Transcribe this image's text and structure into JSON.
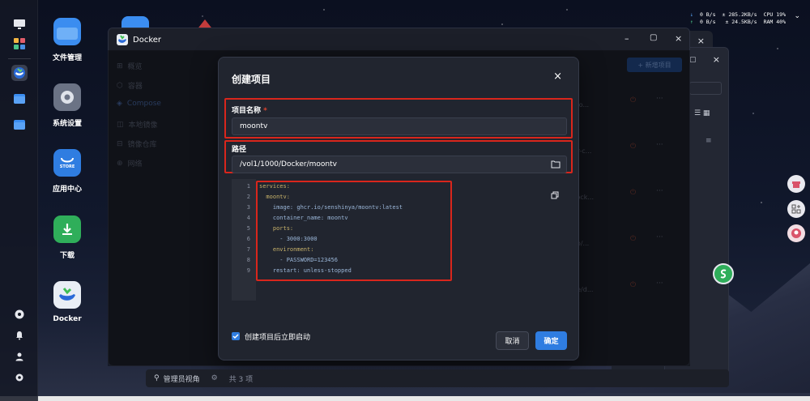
{
  "desktop": {
    "icons": [
      {
        "label": "文件管理"
      },
      {
        "label": "系统设置"
      },
      {
        "label": "应用中心",
        "sublabel": "STORE"
      },
      {
        "label": "下载"
      },
      {
        "label": "Docker"
      }
    ]
  },
  "status": {
    "net_up_label": "0 B/s",
    "net_down_label": "0 B/s",
    "net_up2": "285.2KB/s",
    "net_down2": "24.5KB/s",
    "cpu_label": "CPU",
    "cpu_value": "19%",
    "ram_label": "RAM",
    "ram_value": "40%"
  },
  "window": {
    "title": "Docker",
    "sidebar": [
      {
        "label": "概览",
        "icon": "grid-icon"
      },
      {
        "label": "容器",
        "icon": "cube-icon"
      },
      {
        "label": "Compose",
        "icon": "layers-icon"
      },
      {
        "label": "本地镜像",
        "icon": "image-icon"
      },
      {
        "label": "镜像仓库",
        "icon": "storage-icon"
      },
      {
        "label": "网络",
        "icon": "globe-icon"
      }
    ],
    "new_project_button": "+ 新增项目",
    "bg_rows": [
      "ntv/do...",
      "ocker-c...",
      "ev/dock...",
      "h/app/...",
      "dflare/d..."
    ]
  },
  "modal": {
    "title": "创建项目",
    "name_label": "项目名称",
    "name_required": "*",
    "name_value": "moontv",
    "path_label": "路径",
    "path_value": "/vol1/1000/Docker/moontv",
    "code_lines": [
      {
        "n": "1",
        "text": "services:"
      },
      {
        "n": "2",
        "text": "  moontv:"
      },
      {
        "n": "3",
        "text": "    image: ghcr.io/senshinya/moontv:latest"
      },
      {
        "n": "4",
        "text": "    container_name: moontv"
      },
      {
        "n": "5",
        "text": "    ports:"
      },
      {
        "n": "6",
        "text": "      - 3000:3000"
      },
      {
        "n": "7",
        "text": "    environment:"
      },
      {
        "n": "8",
        "text": "      - PASSWORD=123456"
      },
      {
        "n": "9",
        "text": "    restart: unless-stopped"
      }
    ],
    "autostart_label": "创建项目后立即启动",
    "autostart_checked": true,
    "cancel_label": "取消",
    "ok_label": "确定"
  },
  "taskbar": {
    "view_label": "管理员视角",
    "count_label": "共 3 项"
  },
  "colors": {
    "accent": "#2f7de1",
    "highlight_box": "#d9261c",
    "required": "#e0452f"
  }
}
